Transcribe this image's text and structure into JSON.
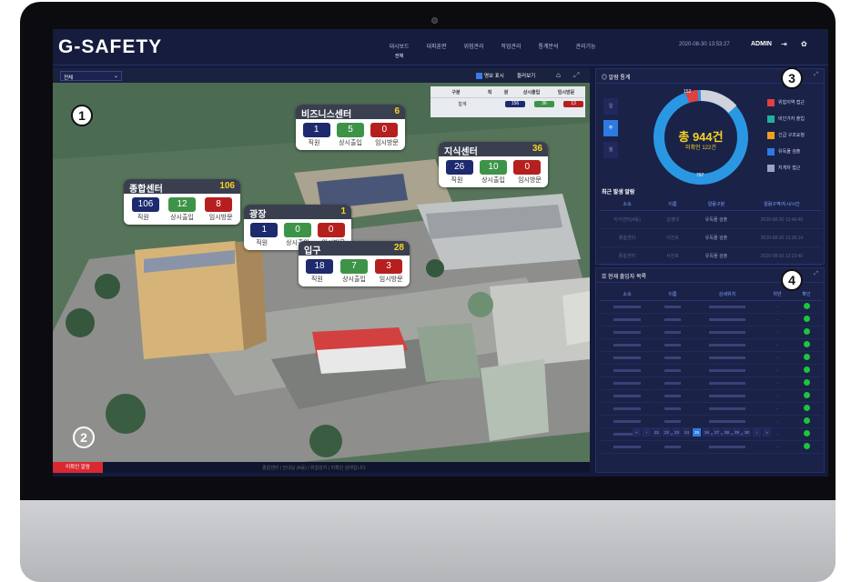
{
  "app": {
    "title": "G-SAFETY",
    "datetime": "2020-08-30  13:53:27",
    "admin": "ADMIN"
  },
  "nav": [
    {
      "label": "대시보드",
      "sub": "전체"
    },
    {
      "label": "대피훈련"
    },
    {
      "label": "위험관리"
    },
    {
      "label": "작업관리"
    },
    {
      "label": "통계분석"
    },
    {
      "label": "관리기능"
    }
  ],
  "map": {
    "select": "전체",
    "toggle_label": "명보 표시",
    "view_label": "둘러보기"
  },
  "bld_table": {
    "headers": [
      "구분",
      "직",
      "원",
      "상시출입",
      "임시방문"
    ],
    "total_label": "합계",
    "total": [
      "156",
      "36",
      "13"
    ]
  },
  "buildings": [
    {
      "name": "비즈니스센터",
      "total": "6",
      "staff": "1",
      "regular": "5",
      "temp": "0"
    },
    {
      "name": "지식센터",
      "total": "36",
      "staff": "26",
      "regular": "10",
      "temp": "0"
    },
    {
      "name": "종합센터",
      "total": "106",
      "staff": "106",
      "regular": "12",
      "temp": "8"
    },
    {
      "name": "광장",
      "total": "1",
      "staff": "1",
      "regular": "0",
      "temp": "0"
    },
    {
      "name": "입구",
      "total": "28",
      "staff": "18",
      "regular": "7",
      "temp": "3"
    }
  ],
  "labels": {
    "staff": "직원",
    "regular": "상시출입",
    "temp": "임시방문"
  },
  "markers": [
    "1",
    "2",
    "3",
    "4"
  ],
  "alarm": {
    "label": "미확인 알람",
    "ticker": "종합센터 | 안내실 (A동) | 위험감지 | 미확인 상태입니다"
  },
  "alarm_stats": {
    "title": "알람 통계",
    "total": "총 944건",
    "unconfirmed": "미확인 122건",
    "seg_top": "152",
    "seg_bottom": "797",
    "tabs": [
      "일",
      "주",
      "월"
    ],
    "legend": [
      "위험지역 접근",
      "비인가자 출입",
      "긴급 구조요청",
      "유독물 검출",
      "지게차 접근"
    ]
  },
  "recent": {
    "title": "최근 발생 알람",
    "headers": [
      "소속",
      "이름",
      "알람구분",
      "알람구역/지시/시간"
    ],
    "rows": [
      {
        "org": "지식센터(A동)",
        "name": "김영대",
        "type": "유독물 검출",
        "time": "2020-08-30 13:46:40"
      },
      {
        "org": "종합센터",
        "name": "이진호",
        "type": "유독물 검출",
        "time": "2020-08-30 13:35:14"
      },
      {
        "org": "종합센터",
        "name": "서진호",
        "type": "유독물 검출",
        "time": "2020-08-30 13:23:40"
      }
    ]
  },
  "access": {
    "title": "현재 출입자 목록",
    "headers": [
      "소속",
      "이름",
      "상세위치",
      "위반",
      "확인"
    ],
    "rows": 12,
    "pages": [
      "«",
      "‹",
      "21",
      "22",
      "23",
      "24",
      "25",
      "26",
      "27",
      "28",
      "29",
      "30",
      "›",
      "»"
    ],
    "active_page": "25"
  },
  "colors": {
    "staff": "#1d2a6e",
    "regular": "#3d9448",
    "temp": "#b5201f",
    "accent": "#2d7be0"
  }
}
